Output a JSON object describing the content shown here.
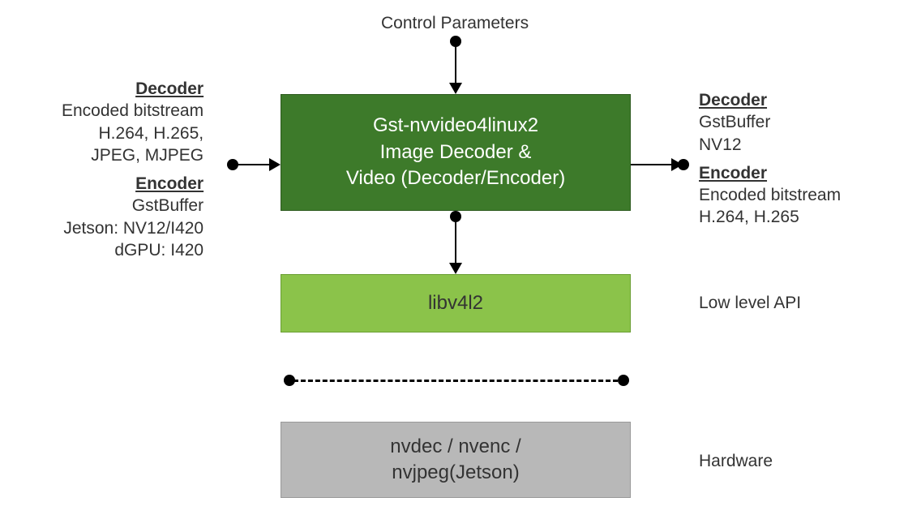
{
  "top_label": "Control Parameters",
  "left_input": {
    "decoder_heading": "Decoder",
    "decoder_line1": "Encoded bitstream",
    "decoder_line2": "H.264, H.265,",
    "decoder_line3": "JPEG, MJPEG",
    "encoder_heading": "Encoder",
    "encoder_line1": "GstBuffer",
    "encoder_line2": "Jetson: NV12/I420",
    "encoder_line3": "dGPU: I420"
  },
  "right_output": {
    "decoder_heading": "Decoder",
    "decoder_line1": "GstBuffer",
    "decoder_line2": "NV12",
    "encoder_heading": "Encoder",
    "encoder_line1": "Encoded bitstream",
    "encoder_line2": "H.264, H.265"
  },
  "main_box": {
    "line1": "Gst-nvvideo4linux2",
    "line2": "Image Decoder &",
    "line3": "Video (Decoder/Encoder)"
  },
  "libv4l2_box": "libv4l2",
  "low_level_label": "Low level API",
  "hardware_box": {
    "line1": "nvdec / nvenc /",
    "line2": "nvjpeg(Jetson)"
  },
  "hardware_label": "Hardware"
}
